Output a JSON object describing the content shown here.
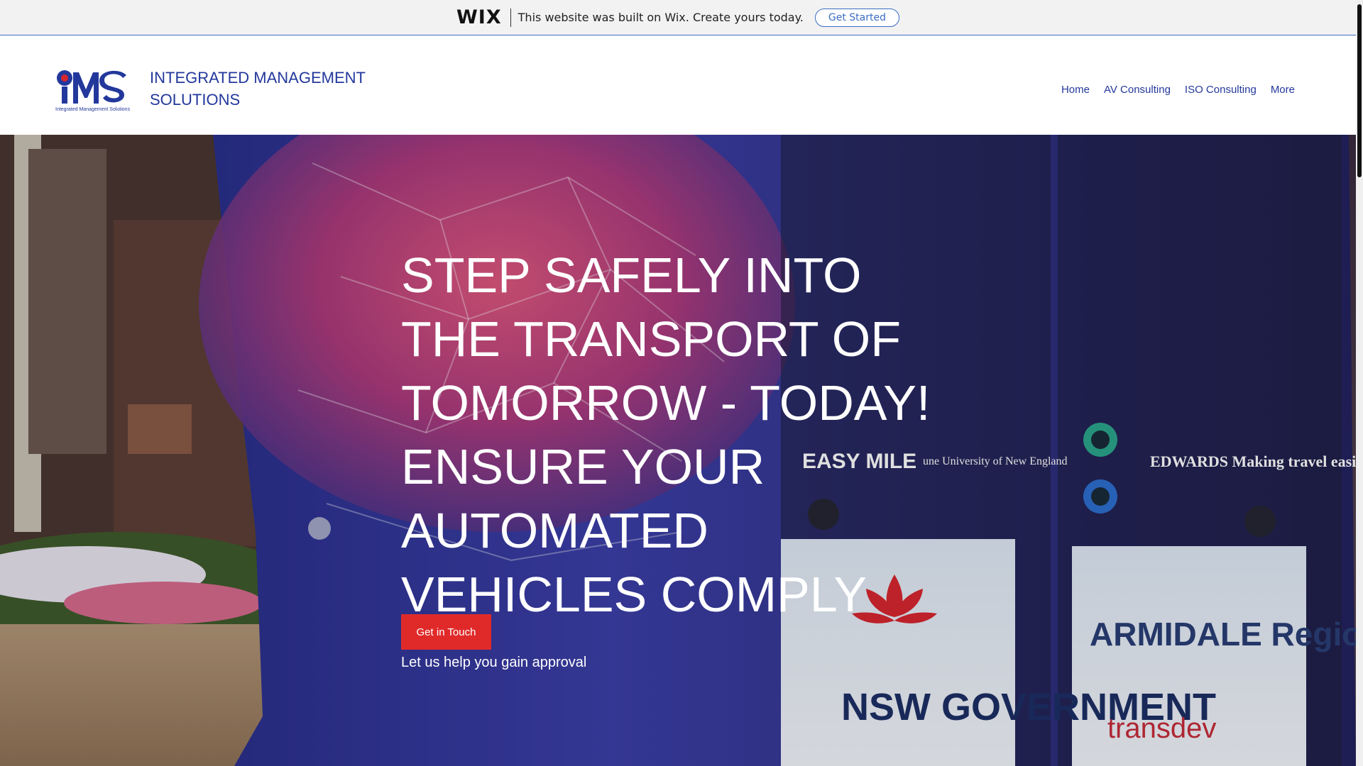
{
  "wix_banner": {
    "logo_text": "WIX",
    "message": "This website was built on Wix. Create yours today.",
    "button_label": "Get Started"
  },
  "header": {
    "logo_alt": "IMS Integrated Management Solutions logo",
    "logo_tagline": "Integrated Management Solutions",
    "title_line1": "INTEGRATED MANAGEMENT",
    "title_line2": "SOLUTIONS",
    "nav": [
      {
        "label": "Home"
      },
      {
        "label": "AV Consulting"
      },
      {
        "label": "ISO Consulting"
      },
      {
        "label": "More"
      }
    ]
  },
  "hero": {
    "heading_lines": [
      "STEP SAFELY INTO",
      "THE TRANSPORT OF",
      "TOMORROW - TODAY!",
      "ENSURE YOUR",
      "AUTOMATED",
      "VEHICLES COMPLY"
    ],
    "subheading": "Let us help you gain approval",
    "cta_label": "Get in Touch",
    "sponsor_logos": [
      "EASY MILE",
      "une University of New England",
      "EDWARDS Making travel easier.",
      "NSW GOVERNMENT",
      "ARMIDALE Regional Council",
      "transdev"
    ]
  },
  "colors": {
    "brand_blue": "#23389c",
    "wix_blue": "#3b6dc4",
    "cta_red": "#e02a2a",
    "logo_red": "#d8262f"
  }
}
